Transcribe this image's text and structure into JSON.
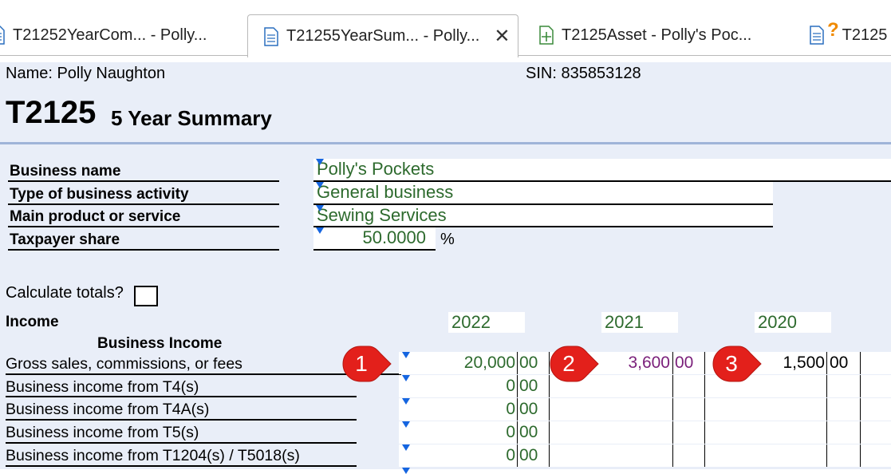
{
  "tabs": [
    {
      "label": "T21252YearCom... - Polly...",
      "icon": "document-icon",
      "active": false
    },
    {
      "label": "T21255YearSum... - Polly...",
      "icon": "document-icon",
      "active": true,
      "close": "✕"
    },
    {
      "label": "T2125Asset - Polly's Poc...",
      "icon": "document-plus-icon",
      "active": false
    },
    {
      "label": "T2125",
      "icon": "document-question-icon",
      "active": false,
      "badge": "?"
    }
  ],
  "header": {
    "name_label": "Name:  Polly Naughton",
    "sin_label": "SIN:  835853128",
    "form_code": "T2125",
    "form_title": "5 Year Summary"
  },
  "business": {
    "name_label": "Business name",
    "name_value": "Polly's Pockets",
    "activity_label": "Type of business activity",
    "activity_value": "General business",
    "product_label": "Main product or service",
    "product_value": "Sewing Services",
    "share_label": "Taxpayer share",
    "share_value": "50.0000",
    "share_unit": "%"
  },
  "calc_totals_label": "Calculate totals?",
  "income": {
    "heading": "Income",
    "subheading": "Business Income",
    "years": [
      "2022",
      "2021",
      "2020"
    ],
    "rows": [
      {
        "label": "Gross sales, commissions, or fees",
        "v2022": "20,000",
        "c2022": "00",
        "v2021": "3,600",
        "c2021": "00",
        "v2020": "1,500",
        "c2020": "00"
      },
      {
        "label": "Business income from T4(s)",
        "v2022": "0",
        "c2022": "00"
      },
      {
        "label": "Business income from T4A(s)",
        "v2022": "0",
        "c2022": "00"
      },
      {
        "label": "Business income from T5(s)",
        "v2022": "0",
        "c2022": "00"
      },
      {
        "label": "Business income from T1204(s) / T5018(s)",
        "v2022": "0",
        "c2022": "00"
      }
    ]
  },
  "callouts": [
    "1",
    "2",
    "3"
  ],
  "colors": {
    "green_value": "#2d6a2d",
    "purple_value": "#7a1f7a",
    "callout_red": "#e3201b",
    "form_bg": "#e9eef8",
    "marker_blue": "#1565e0",
    "tab_badge_orange": "#f08a00"
  }
}
